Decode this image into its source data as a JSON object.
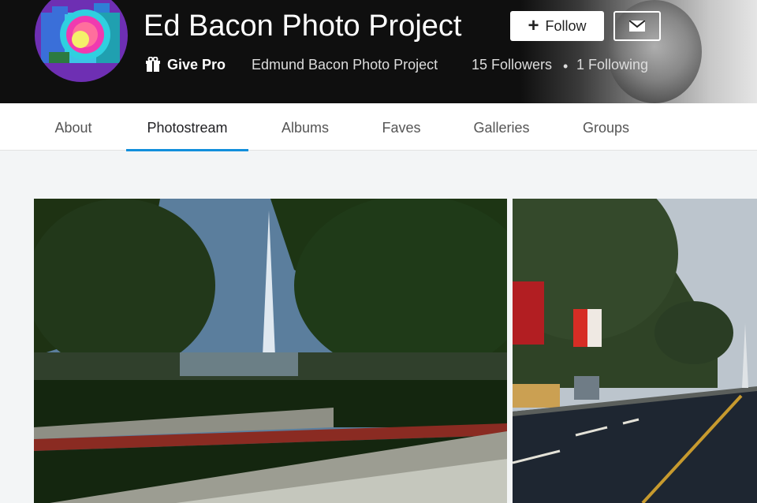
{
  "profile": {
    "title": "Ed Bacon Photo Project",
    "give_pro_label": "Give Pro",
    "real_name": "Edmund Bacon Photo Project",
    "followers": "15 Followers",
    "separator": "•",
    "following": "1 Following"
  },
  "actions": {
    "follow_label": "Follow"
  },
  "tabs": [
    {
      "label": "About"
    },
    {
      "label": "Photostream"
    },
    {
      "label": "Albums"
    },
    {
      "label": "Faves"
    },
    {
      "label": "Galleries"
    },
    {
      "label": "Groups"
    }
  ],
  "active_tab": "Photostream",
  "colors": {
    "accent": "#128fdc",
    "header_bg": "#0f0f0f",
    "avatar_bg": "#6e2fb3"
  },
  "icons": {
    "follow": "plus-icon",
    "message": "mail-icon",
    "give_pro": "gift-icon"
  }
}
